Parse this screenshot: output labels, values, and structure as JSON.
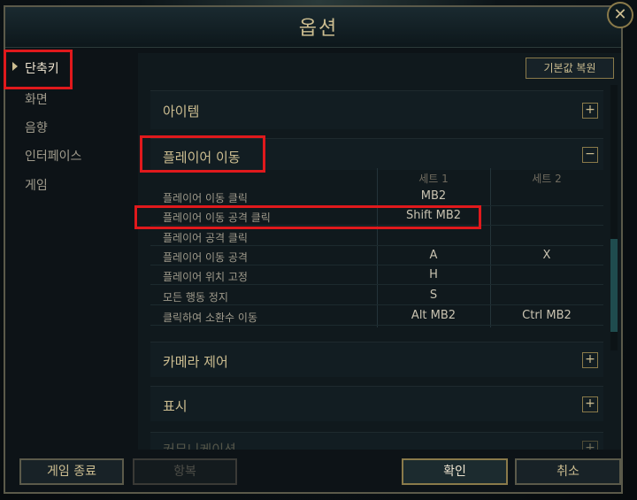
{
  "window": {
    "title": "옵션",
    "close_symbol": "✕"
  },
  "sidebar": {
    "items": [
      {
        "label": "단축키",
        "active": true
      },
      {
        "label": "화면"
      },
      {
        "label": "음향"
      },
      {
        "label": "인터페이스"
      },
      {
        "label": "게임"
      }
    ]
  },
  "panel": {
    "reset_label": "기본값 복원",
    "sections": {
      "items": {
        "title": "아이템",
        "toggle": "+"
      },
      "movement": {
        "title": "플레이어 이동",
        "toggle": "−"
      },
      "camera": {
        "title": "카메라 제어",
        "toggle": "+"
      },
      "display": {
        "title": "표시",
        "toggle": "+"
      },
      "cutoff": {
        "title": "커뮤니케이션",
        "toggle": "+"
      }
    },
    "columns": {
      "set1": "세트 1",
      "set2": "세트 2"
    },
    "rows": [
      {
        "label": "플레이어 이동 클릭",
        "set1": "MB2",
        "set2": ""
      },
      {
        "label": "플레이어 이동 공격 클릭",
        "set1": "Shift  MB2",
        "set2": ""
      },
      {
        "label": "플레이어 공격 클릭",
        "set1": "",
        "set2": ""
      },
      {
        "label": "플레이어 이동 공격",
        "set1": "A",
        "set2": "X"
      },
      {
        "label": "플레이어 위치 고정",
        "set1": "H",
        "set2": ""
      },
      {
        "label": "모든 행동 정지",
        "set1": "S",
        "set2": ""
      },
      {
        "label": "클릭하여 소환수 이동",
        "set1": "Alt  MB2",
        "set2": "Ctrl  MB2"
      }
    ]
  },
  "footer": {
    "quit_label": "게임 종료",
    "surrender_label": "항복",
    "ok_label": "확인",
    "cancel_label": "취소"
  },
  "colors": {
    "accent": "#cdbe91",
    "highlight": "#e0191c",
    "background": "#0d1317"
  }
}
